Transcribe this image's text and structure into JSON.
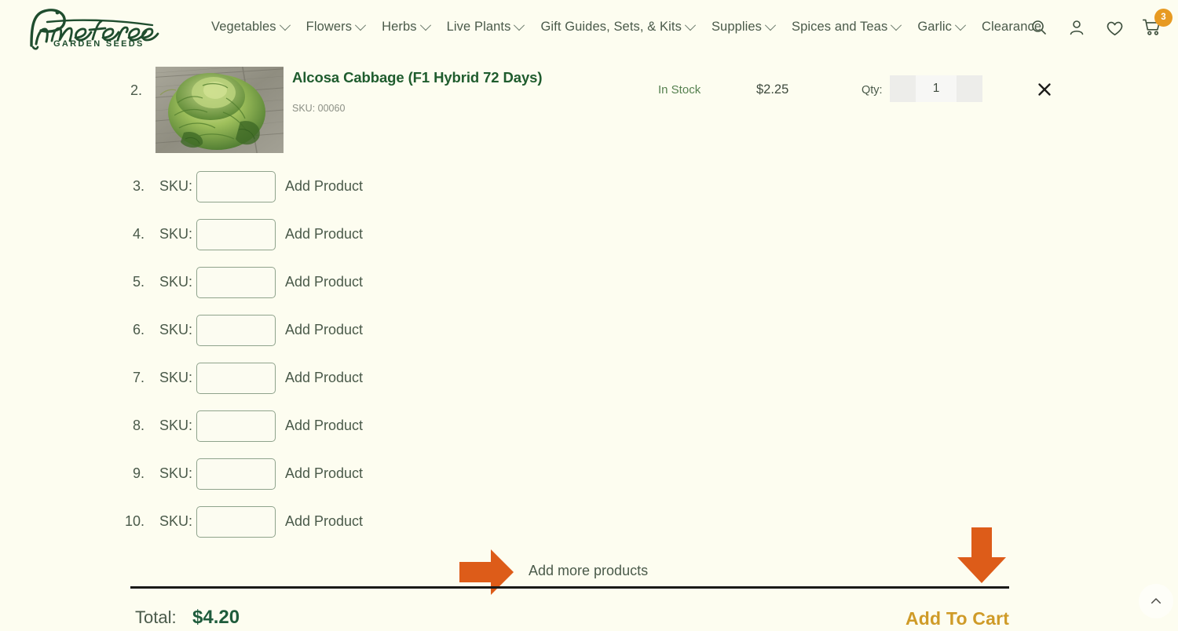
{
  "header": {
    "brand_name": "Pinetree",
    "brand_tagline": "GARDEN SEEDS",
    "nav_items": [
      {
        "label": "Vegetables",
        "has_dropdown": true
      },
      {
        "label": "Flowers",
        "has_dropdown": true
      },
      {
        "label": "Herbs",
        "has_dropdown": true
      },
      {
        "label": "Live Plants",
        "has_dropdown": true
      },
      {
        "label": "Gift Guides, Sets, & Kits",
        "has_dropdown": true
      },
      {
        "label": "Supplies",
        "has_dropdown": true
      },
      {
        "label": "Spices and Teas",
        "has_dropdown": true
      },
      {
        "label": "Garlic",
        "has_dropdown": true
      },
      {
        "label": "Clearance",
        "has_dropdown": false
      }
    ],
    "icons": [
      {
        "name": "search-icon"
      },
      {
        "name": "account-icon"
      },
      {
        "name": "wishlist-heart-icon"
      },
      {
        "name": "cart-icon"
      }
    ],
    "cart_count": "3",
    "cart_badge_color": "#e79a22"
  },
  "product_row": {
    "index": "2.",
    "title": "Alcosa Cabbage (F1 Hybrid 72 Days)",
    "sku": "SKU: 00060",
    "stock": "In Stock",
    "price": "$2.25",
    "qty_label": "Qty:",
    "qty_value": "1",
    "qty_decrease": "−",
    "qty_increase": "+",
    "remove_icon": "close-icon",
    "image_alt": "savoy cabbage on weathered wood"
  },
  "sku_rows": [
    {
      "num": "3.",
      "label": "SKU:",
      "value": "",
      "placeholder": "",
      "action": "Add Product"
    },
    {
      "num": "4.",
      "label": "SKU:",
      "value": "",
      "placeholder": "",
      "action": "Add Product"
    },
    {
      "num": "5.",
      "label": "SKU:",
      "value": "",
      "placeholder": "",
      "action": "Add Product"
    },
    {
      "num": "6.",
      "label": "SKU:",
      "value": "",
      "placeholder": "",
      "action": "Add Product"
    },
    {
      "num": "7.",
      "label": "SKU:",
      "value": "",
      "placeholder": "",
      "action": "Add Product"
    },
    {
      "num": "8.",
      "label": "SKU:",
      "value": "",
      "placeholder": "",
      "action": "Add Product"
    },
    {
      "num": "9.",
      "label": "SKU:",
      "value": "",
      "placeholder": "",
      "action": "Add Product"
    },
    {
      "num": "10.",
      "label": "SKU:",
      "value": "",
      "placeholder": "",
      "action": "Add Product"
    }
  ],
  "footer": {
    "add_more_label": "Add more products",
    "arrow_color": "#dd5c19",
    "total_label": "Total:",
    "total_value": "$4.20",
    "add_to_cart_label": "Add To Cart",
    "add_to_cart_color": "#cf9b28",
    "scroll_top_icon": "chevron-up-icon"
  },
  "theme": {
    "page_background": "#fdfdf0",
    "brand_green": "#1f4d2e",
    "text_green": "#4a5a4a",
    "link_green": "#1f5c2e"
  }
}
